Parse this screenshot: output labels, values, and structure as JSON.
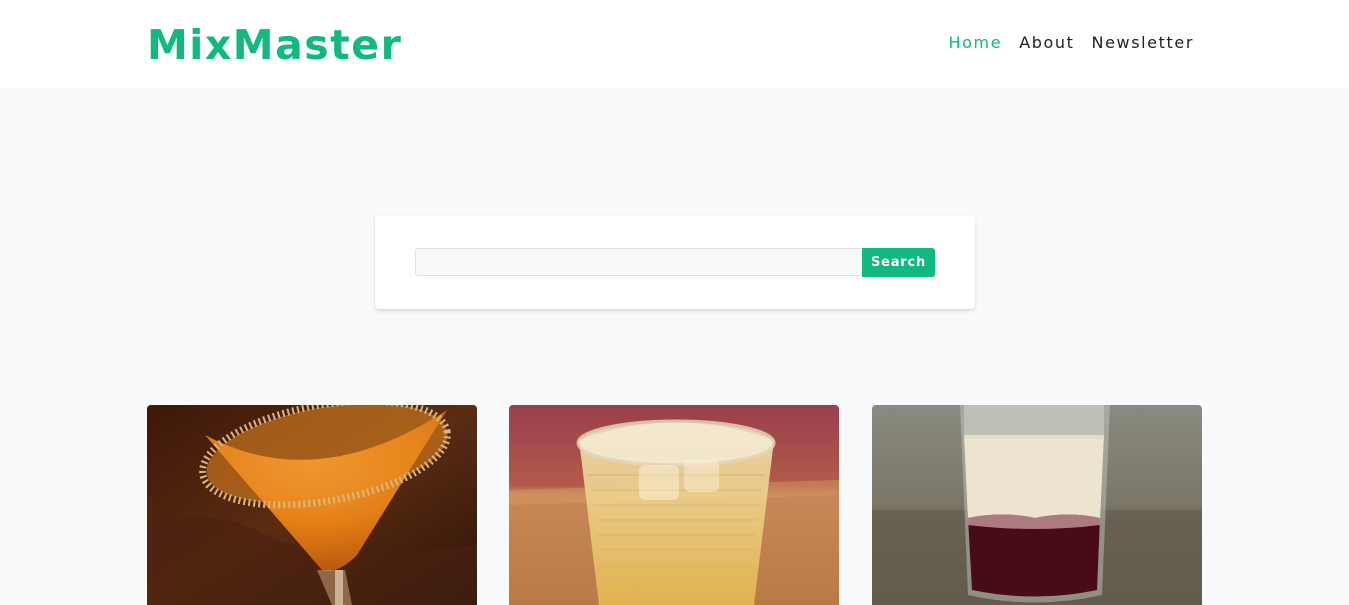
{
  "header": {
    "brand": "MixMaster",
    "nav": [
      {
        "label": "Home",
        "active": true
      },
      {
        "label": "About",
        "active": false
      },
      {
        "label": "Newsletter",
        "active": false
      }
    ]
  },
  "search": {
    "value": "",
    "placeholder": "",
    "button_label": "Search"
  },
  "cards": [
    {
      "image": "orange-martini-sugar-rim-image"
    },
    {
      "image": "amber-drink-rocks-glass-image"
    },
    {
      "image": "layered-shot-glass-image"
    }
  ],
  "colors": {
    "accent": "#10b981",
    "page_background": "#f8f9fa",
    "header_background": "#ffffff",
    "nav_text": "#222222"
  }
}
